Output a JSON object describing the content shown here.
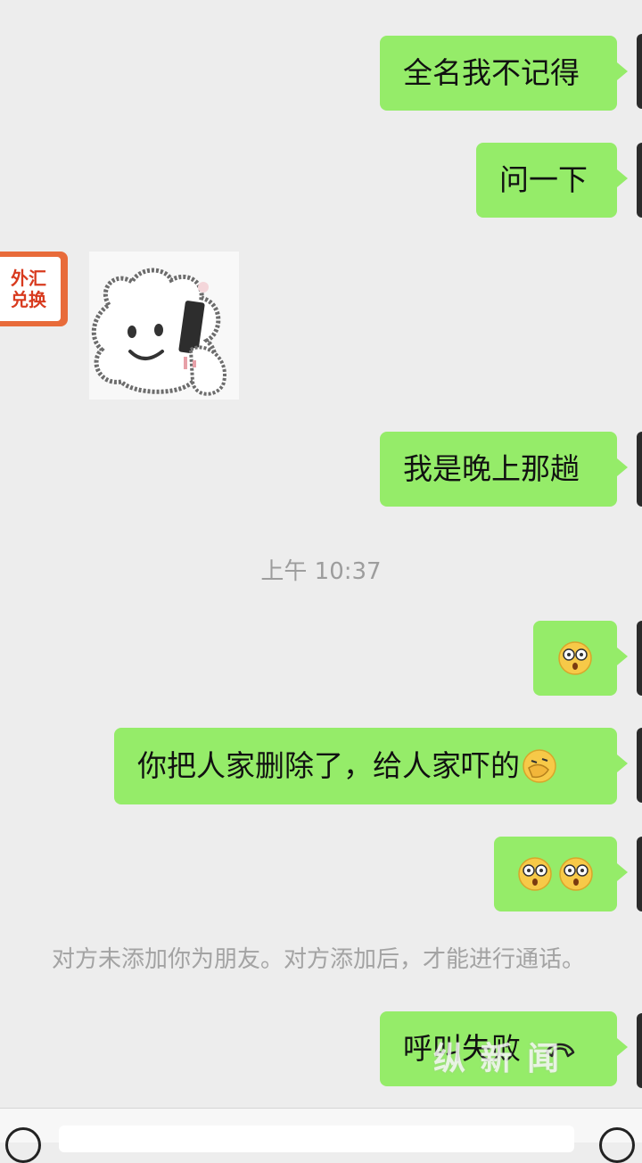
{
  "messages": {
    "m1": "全名我不记得",
    "m2": "问一下",
    "m3": "我是晚上那趟",
    "m5": "你把人家删除了，给人家吓的",
    "m7": "呼叫失败"
  },
  "sticker": {
    "icon": "bear-holding-phone-sticker"
  },
  "avatar_left": {
    "line1": "外汇",
    "line2": "兑换"
  },
  "timestamp": "上午 10:37",
  "system_notice": "对方未添加你为朋友。对方添加后，才能进行通话。",
  "watermark": "纵 新 闻",
  "colors": {
    "bubble": "#95ec69",
    "background": "#ededed",
    "timestamp": "#9d9d9d"
  }
}
